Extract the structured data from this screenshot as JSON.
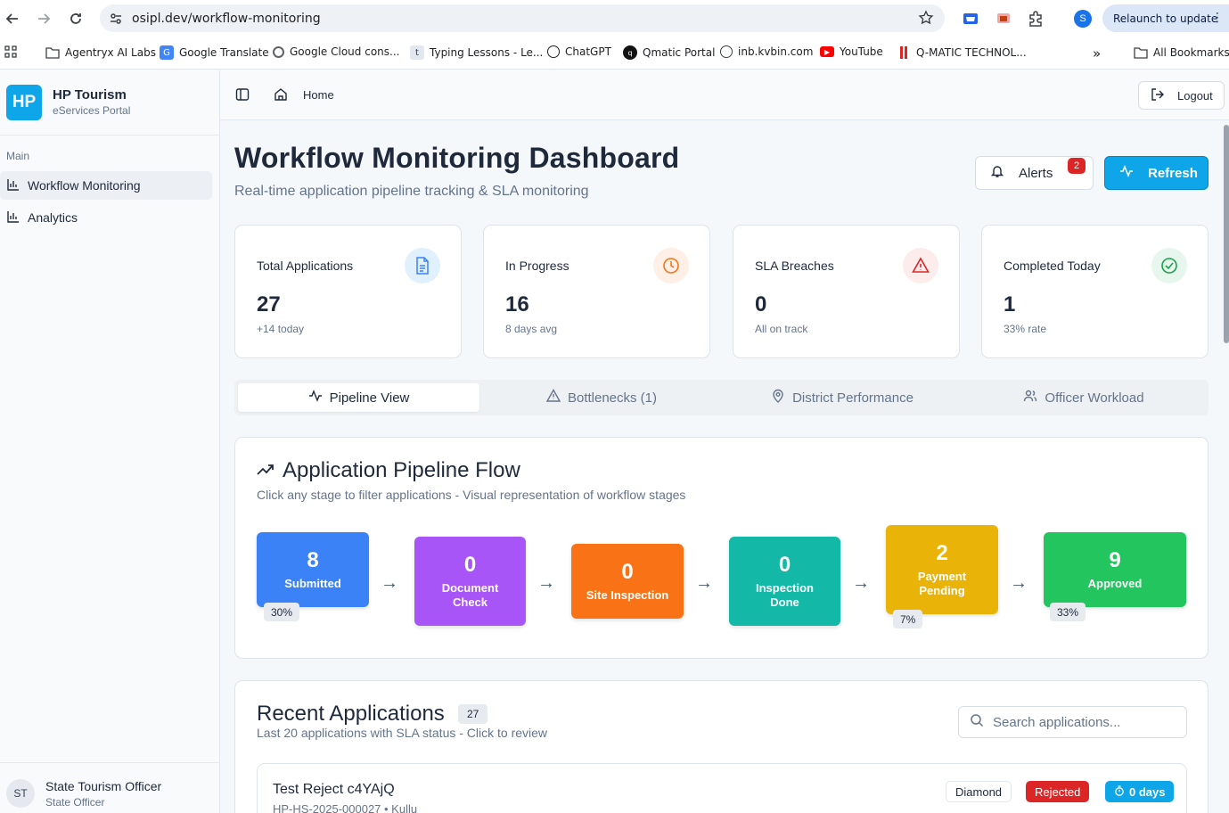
{
  "browser": {
    "url": "osipl.dev/workflow-monitoring",
    "relaunch_label": "Relaunch to update",
    "profile_initial": "S",
    "bookmarks": [
      "Agentryx AI Labs",
      "Google Translate",
      "Google Cloud cons...",
      "Typing Lessons - Le...",
      "ChatGPT",
      "Qmatic Portal",
      "inb.kvbin.com",
      "YouTube",
      "Q-MATIC TECHNOL..."
    ],
    "all_bookmarks": "All Bookmarks"
  },
  "sidebar": {
    "logo": "HP",
    "title": "HP Tourism",
    "subtitle": "eServices Portal",
    "section": "Main",
    "items": [
      {
        "label": "Workflow Monitoring",
        "active": true
      },
      {
        "label": "Analytics",
        "active": false
      }
    ],
    "user": {
      "initials": "ST",
      "name": "State Tourism Officer",
      "role": "State Officer"
    }
  },
  "topbar": {
    "home": "Home",
    "logout": "Logout"
  },
  "header": {
    "title": "Workflow Monitoring Dashboard",
    "subtitle": "Real-time application pipeline tracking & SLA monitoring",
    "alerts_label": "Alerts",
    "alerts_count": "2",
    "refresh_label": "Refresh"
  },
  "stats": [
    {
      "label": "Total Applications",
      "value": "27",
      "note": "+14 today",
      "color": "#3b82f6"
    },
    {
      "label": "In Progress",
      "value": "16",
      "note": "8 days avg",
      "color": "#f97316"
    },
    {
      "label": "SLA Breaches",
      "value": "0",
      "note": "All on track",
      "color": "#dc2626"
    },
    {
      "label": "Completed Today",
      "value": "1",
      "note": "33% rate",
      "color": "#16a34a"
    }
  ],
  "tabs": [
    {
      "label": "Pipeline View",
      "active": true
    },
    {
      "label": "Bottlenecks (1)",
      "active": false
    },
    {
      "label": "District Performance",
      "active": false
    },
    {
      "label": "Officer Workload",
      "active": false
    }
  ],
  "pipeline": {
    "title": "Application Pipeline Flow",
    "subtitle": "Click any stage to filter applications - Visual representation of workflow stages",
    "stages": [
      {
        "count": "8",
        "label": "Submitted",
        "pct": "30%",
        "color": "#3b82f6"
      },
      {
        "count": "0",
        "label": "Document Check",
        "pct": "",
        "color": "#a855f7"
      },
      {
        "count": "0",
        "label": "Site Inspection",
        "pct": "",
        "color": "#f97316"
      },
      {
        "count": "0",
        "label": "Inspection Done",
        "pct": "",
        "color": "#14b8a6"
      },
      {
        "count": "2",
        "label": "Payment Pending",
        "pct": "7%",
        "color": "#eab308"
      },
      {
        "count": "9",
        "label": "Approved",
        "pct": "33%",
        "color": "#22c55e"
      }
    ]
  },
  "recent": {
    "title": "Recent Applications",
    "count": "27",
    "subtitle": "Last 20 applications with SLA status - Click to review",
    "search_placeholder": "Search applications...",
    "rows": [
      {
        "title": "Test Reject c4YAjQ",
        "sub": "HP-HS-2025-000027 • Kullu",
        "category": "Diamond",
        "status": "Rejected",
        "days": "0 days"
      }
    ]
  }
}
